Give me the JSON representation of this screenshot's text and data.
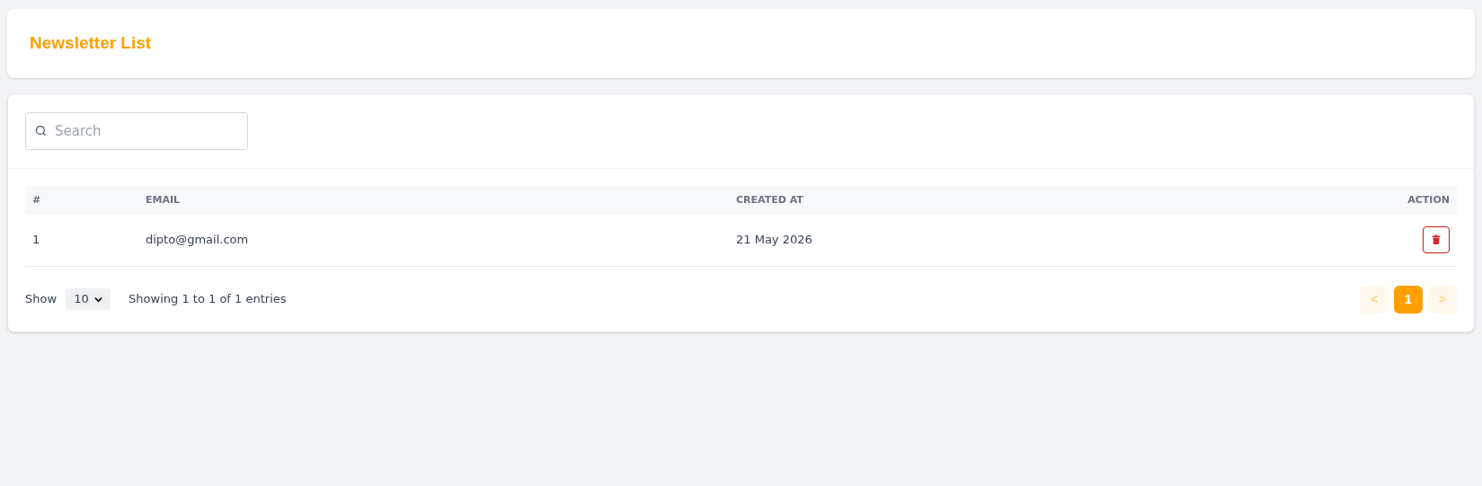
{
  "header": {
    "title": "Newsletter List"
  },
  "search": {
    "placeholder": "Search"
  },
  "table": {
    "columns": [
      "#",
      "EMAIL",
      "CREATED AT",
      "ACTION"
    ],
    "rows": [
      {
        "cells": [
          "1",
          "dipto@gmail.com",
          "21 May 2026"
        ]
      }
    ]
  },
  "footer": {
    "show_label": "Show",
    "page_size": "10",
    "summary": "Showing 1 to 1 of 1 entries",
    "prev": {
      "label": "<",
      "disabled": true
    },
    "pages": [
      {
        "label": "1",
        "selected": true
      }
    ],
    "next": {
      "label": ">",
      "disabled": true
    }
  }
}
